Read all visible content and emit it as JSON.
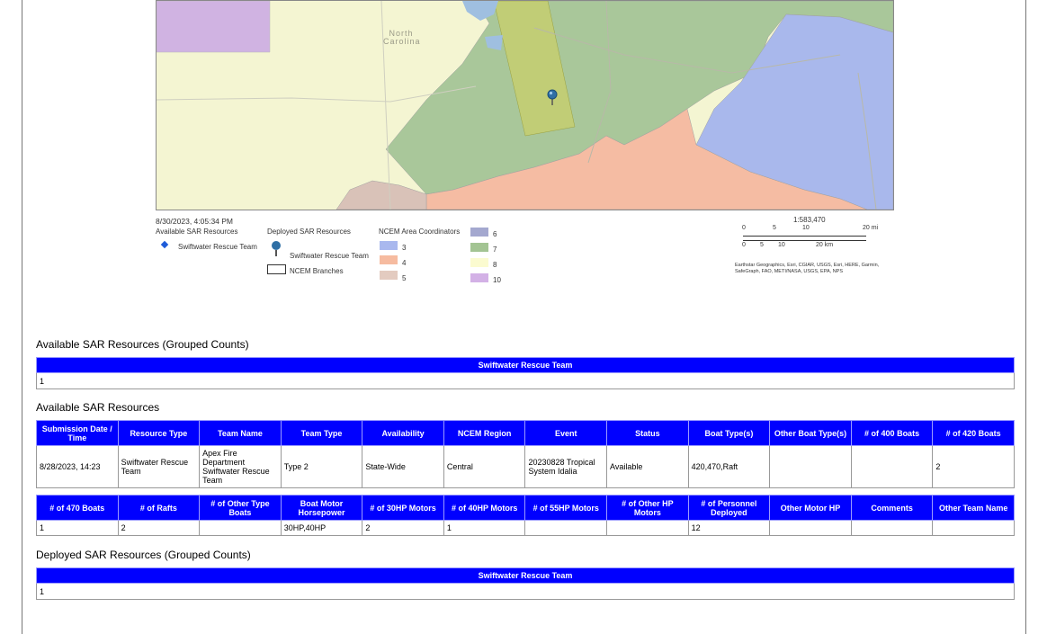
{
  "map": {
    "timestamp": "8/30/2023, 4:05:34 PM",
    "state_label": "North Carolina",
    "legend": {
      "available_title": "Available SAR Resources",
      "available_item": "Swiftwater Rescue Team",
      "deployed_title": "Deployed SAR Resources",
      "deployed_item": "Swiftwater Rescue Team",
      "branches_label": "NCEM Branches",
      "area_title": "NCEM Area Coordinators",
      "areas": [
        {
          "label": "3",
          "color": "#a9b8ee"
        },
        {
          "label": "4",
          "color": "#f6bba0"
        },
        {
          "label": "5",
          "color": "#e3cbc0"
        },
        {
          "label": "6",
          "color": "#a4a8cf"
        },
        {
          "label": "7",
          "color": "#a3c493"
        },
        {
          "label": "8",
          "color": "#fbfbd0"
        },
        {
          "label": "10",
          "color": "#d3b1e6"
        }
      ]
    },
    "scale": {
      "ratio": "1:583,470",
      "mi_ticks": [
        "0",
        "5",
        "10",
        "20 mi"
      ],
      "km_ticks": [
        "0",
        "5",
        "10",
        "20 km"
      ]
    },
    "attribution_1": "Earthstar Geographics, Esri, CGIAR, USGS, Esri, HERE, Garmin,",
    "attribution_2": "SafeGraph, FAO, METI/NASA, USGS, EPA, NPS"
  },
  "grouped_available": {
    "title": "Available SAR Resources (Grouped Counts)",
    "header": "Swiftwater Rescue Team",
    "value": "1"
  },
  "available": {
    "title": "Available SAR Resources",
    "headers1": [
      "Submission Date / Time",
      "Resource Type",
      "Team Name",
      "Team Type",
      "Availability",
      "NCEM Region",
      "Event",
      "Status",
      "Boat Type(s)",
      "Other Boat Type(s)",
      "# of 400 Boats",
      "# of 420 Boats"
    ],
    "row1": [
      "8/28/2023, 14:23",
      "Swiftwater Rescue Team",
      "Apex Fire Department Swiftwater Rescue Team",
      "Type 2",
      "State-Wide",
      "Central",
      "20230828 Tropical System Idalia",
      "Available",
      "420,470,Raft",
      "",
      "",
      "2"
    ],
    "headers2": [
      "# of 470 Boats",
      "# of Rafts",
      "# of Other Type Boats",
      "Boat Motor Horsepower",
      "# of 30HP Motors",
      "# of 40HP Motors",
      "# of 55HP Motors",
      "# of Other HP Motors",
      "# of Personnel Deployed",
      "Other Motor HP",
      "Comments",
      "Other Team Name"
    ],
    "row2": [
      "1",
      "2",
      "",
      "30HP,40HP",
      "2",
      "1",
      "",
      "",
      "12",
      "",
      "",
      ""
    ]
  },
  "grouped_deployed": {
    "title": "Deployed SAR Resources (Grouped Counts)",
    "header": "Swiftwater Rescue Team",
    "value": "1"
  }
}
